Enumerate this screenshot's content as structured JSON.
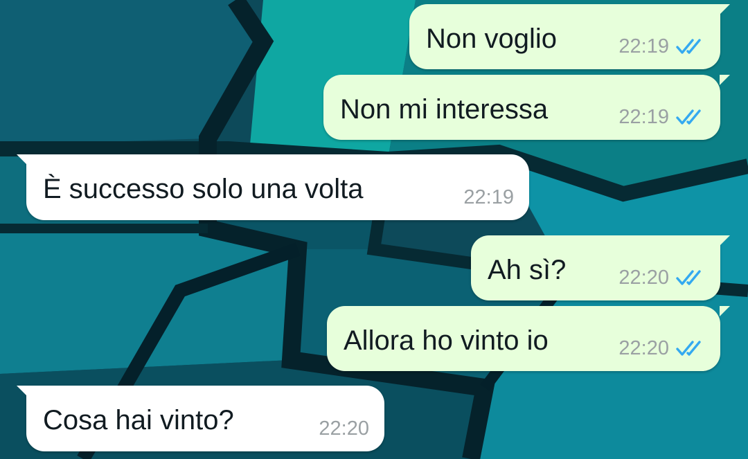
{
  "colors": {
    "outgoing_bubble": "#e7ffdb",
    "incoming_bubble": "#ffffff",
    "read_ticks": "#34a9f0",
    "timestamp": "#9aa0a3",
    "wallpaper_base": "#0c4b5c"
  },
  "messages": [
    {
      "direction": "outgoing",
      "text": "Non voglio",
      "time": "22:19",
      "status_icon": "double-check-read-icon"
    },
    {
      "direction": "outgoing",
      "text": "Non mi interessa",
      "time": "22:19",
      "status_icon": "double-check-read-icon"
    },
    {
      "direction": "incoming",
      "text": "È successo solo una volta",
      "time": "22:19"
    },
    {
      "direction": "outgoing",
      "text": "Ah sì?",
      "time": "22:20",
      "status_icon": "double-check-read-icon"
    },
    {
      "direction": "outgoing",
      "text": "Allora ho vinto io",
      "time": "22:20",
      "status_icon": "double-check-read-icon"
    },
    {
      "direction": "incoming",
      "text": "Cosa hai vinto?",
      "time": "22:20"
    }
  ]
}
